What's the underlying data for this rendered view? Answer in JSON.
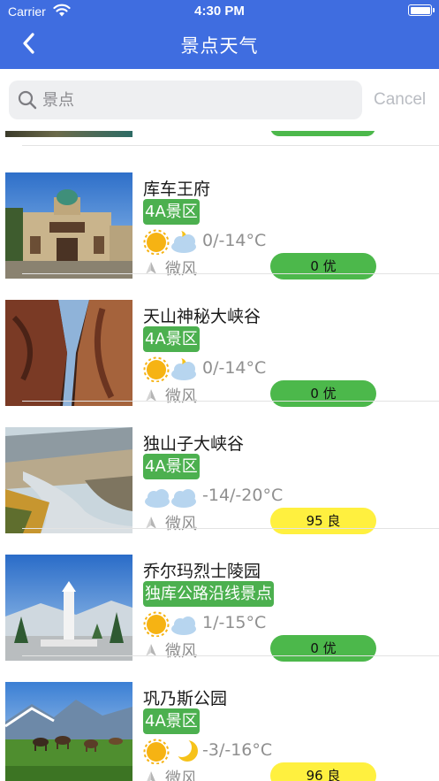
{
  "status_bar": {
    "carrier": "Carrier",
    "time": "4:30 PM"
  },
  "nav": {
    "title": "景点天气"
  },
  "search": {
    "placeholder": "景点",
    "cancel_label": "Cancel"
  },
  "colors": {
    "nav_blue": "#3f6de0",
    "tag_green": "#4cb04f",
    "aqi_good": "#4cb84b",
    "aqi_fair": "#fff03f"
  },
  "spots": [
    {
      "name": "库车王府",
      "tag": "4A景区",
      "weather_icon": "sun-cloud-moon-icon",
      "temp": "0/-14°C",
      "wind": "微风",
      "aqi": "0 优",
      "aqi_level": "good"
    },
    {
      "name": "天山神秘大峡谷",
      "tag": "4A景区",
      "weather_icon": "sun-cloud-moon-icon",
      "temp": "0/-14°C",
      "wind": "微风",
      "aqi": "0 优",
      "aqi_level": "good"
    },
    {
      "name": "独山子大峡谷",
      "tag": "4A景区",
      "weather_icon": "cloud-cloud-icon",
      "temp": "-14/-20°C",
      "wind": "微风",
      "aqi": "95 良",
      "aqi_level": "fair"
    },
    {
      "name": "乔尔玛烈士陵园",
      "tag": "独库公路沿线景点",
      "weather_icon": "sun-cloud-icon",
      "temp": "1/-15°C",
      "wind": "微风",
      "aqi": "0 优",
      "aqi_level": "good"
    },
    {
      "name": "巩乃斯公园",
      "tag": "4A景区",
      "weather_icon": "sun-moon-icon",
      "temp": "-3/-16°C",
      "wind": "微风",
      "aqi": "96 良",
      "aqi_level": "fair"
    }
  ]
}
